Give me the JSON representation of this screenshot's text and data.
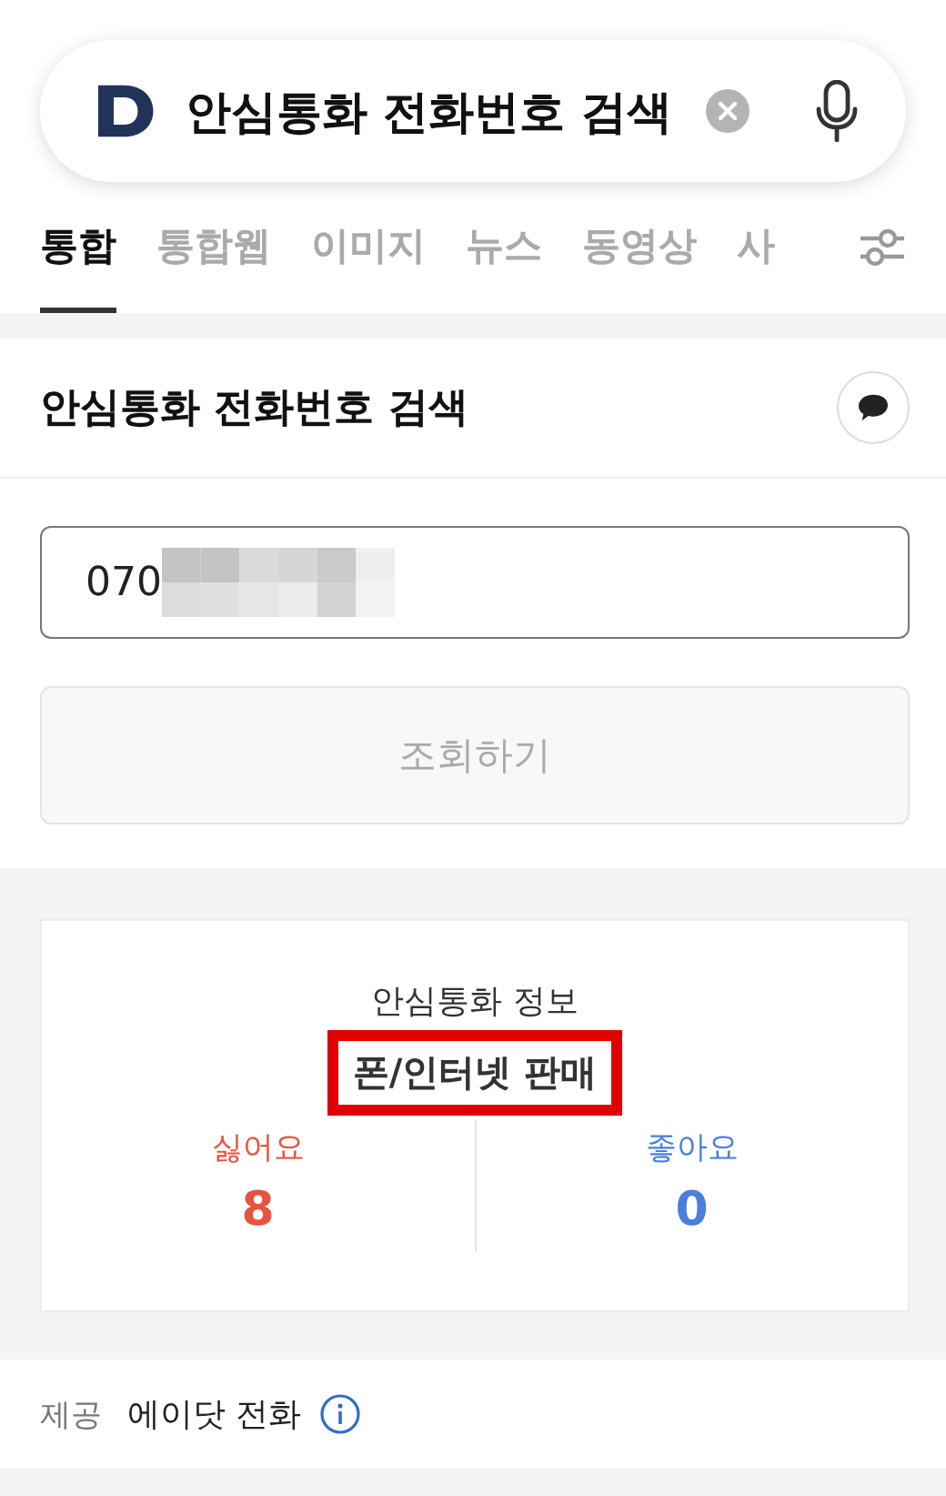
{
  "search": {
    "query": "안심통화 전화번호 검색"
  },
  "tabs": [
    {
      "label": "통합",
      "selected": true
    },
    {
      "label": "통합웹",
      "selected": false
    },
    {
      "label": "이미지",
      "selected": false
    },
    {
      "label": "뉴스",
      "selected": false
    },
    {
      "label": "동영상",
      "selected": false
    },
    {
      "label": "사",
      "selected": false
    }
  ],
  "section": {
    "title": "안심통화 전화번호 검색"
  },
  "phone_field": {
    "value": "070"
  },
  "lookup_button": {
    "label": "조회하기",
    "disabled": true
  },
  "info_card": {
    "heading": "안심통화 정보",
    "category": "폰/인터넷 판매",
    "highlighted": true,
    "stats": [
      {
        "label": "싫어요",
        "value": "8",
        "color": "#e8523f"
      },
      {
        "label": "좋아요",
        "value": "0",
        "color": "#4a7fe0"
      }
    ]
  },
  "footer": {
    "label": "제공",
    "provider": "에이닷 전화"
  }
}
